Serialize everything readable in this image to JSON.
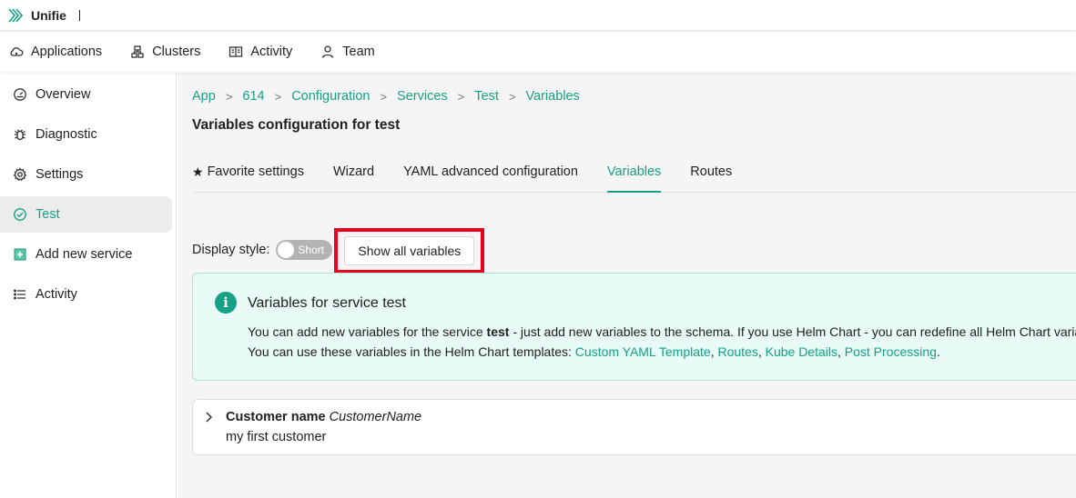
{
  "brand": {
    "name": "Unifie"
  },
  "topnav": {
    "items": [
      {
        "label": "Applications",
        "icon": "cloud-icon"
      },
      {
        "label": "Clusters",
        "icon": "cluster-icon"
      },
      {
        "label": "Activity",
        "icon": "book-icon"
      },
      {
        "label": "Team",
        "icon": "user-icon"
      }
    ]
  },
  "sidebar": {
    "items": [
      {
        "label": "Overview",
        "icon": "dashboard-icon"
      },
      {
        "label": "Diagnostic",
        "icon": "bug-icon"
      },
      {
        "label": "Settings",
        "icon": "gear-icon"
      },
      {
        "label": "Test",
        "icon": "check-circle-icon",
        "active": true
      },
      {
        "label": "Add new service",
        "icon": "plus-square-icon"
      },
      {
        "label": "Activity",
        "icon": "list-icon"
      }
    ]
  },
  "breadcrumb": [
    "App",
    "614",
    "Configuration",
    "Services",
    "Test",
    "Variables"
  ],
  "page_title": "Variables configuration for test",
  "tabs": [
    {
      "label": "Favorite settings",
      "icon": "star-icon"
    },
    {
      "label": "Wizard"
    },
    {
      "label": "YAML advanced configuration"
    },
    {
      "label": "Variables",
      "active": true
    },
    {
      "label": "Routes"
    }
  ],
  "display": {
    "label": "Display style:",
    "toggle_text": "Short",
    "show_all_button": "Show all variables"
  },
  "info": {
    "title": "Variables for service test",
    "line1_prefix": "You can add new variables for the service ",
    "line1_bold": "test",
    "line1_suffix": " - just add new variables to the schema. If you use Helm Chart - you can redefine all Helm Chart variables",
    "line2_prefix": "You can use these variables in the Helm Chart templates: ",
    "links": [
      "Custom YAML Template",
      "Routes",
      "Kube Details",
      "Post Processing"
    ],
    "sep": ", ",
    "end": "."
  },
  "variable": {
    "name": "Customer name",
    "key": "CustomerName",
    "value": "my first customer"
  },
  "colors": {
    "accent": "#16a085",
    "highlight": "#e8001c",
    "info_bg": "#e8fbf7"
  }
}
